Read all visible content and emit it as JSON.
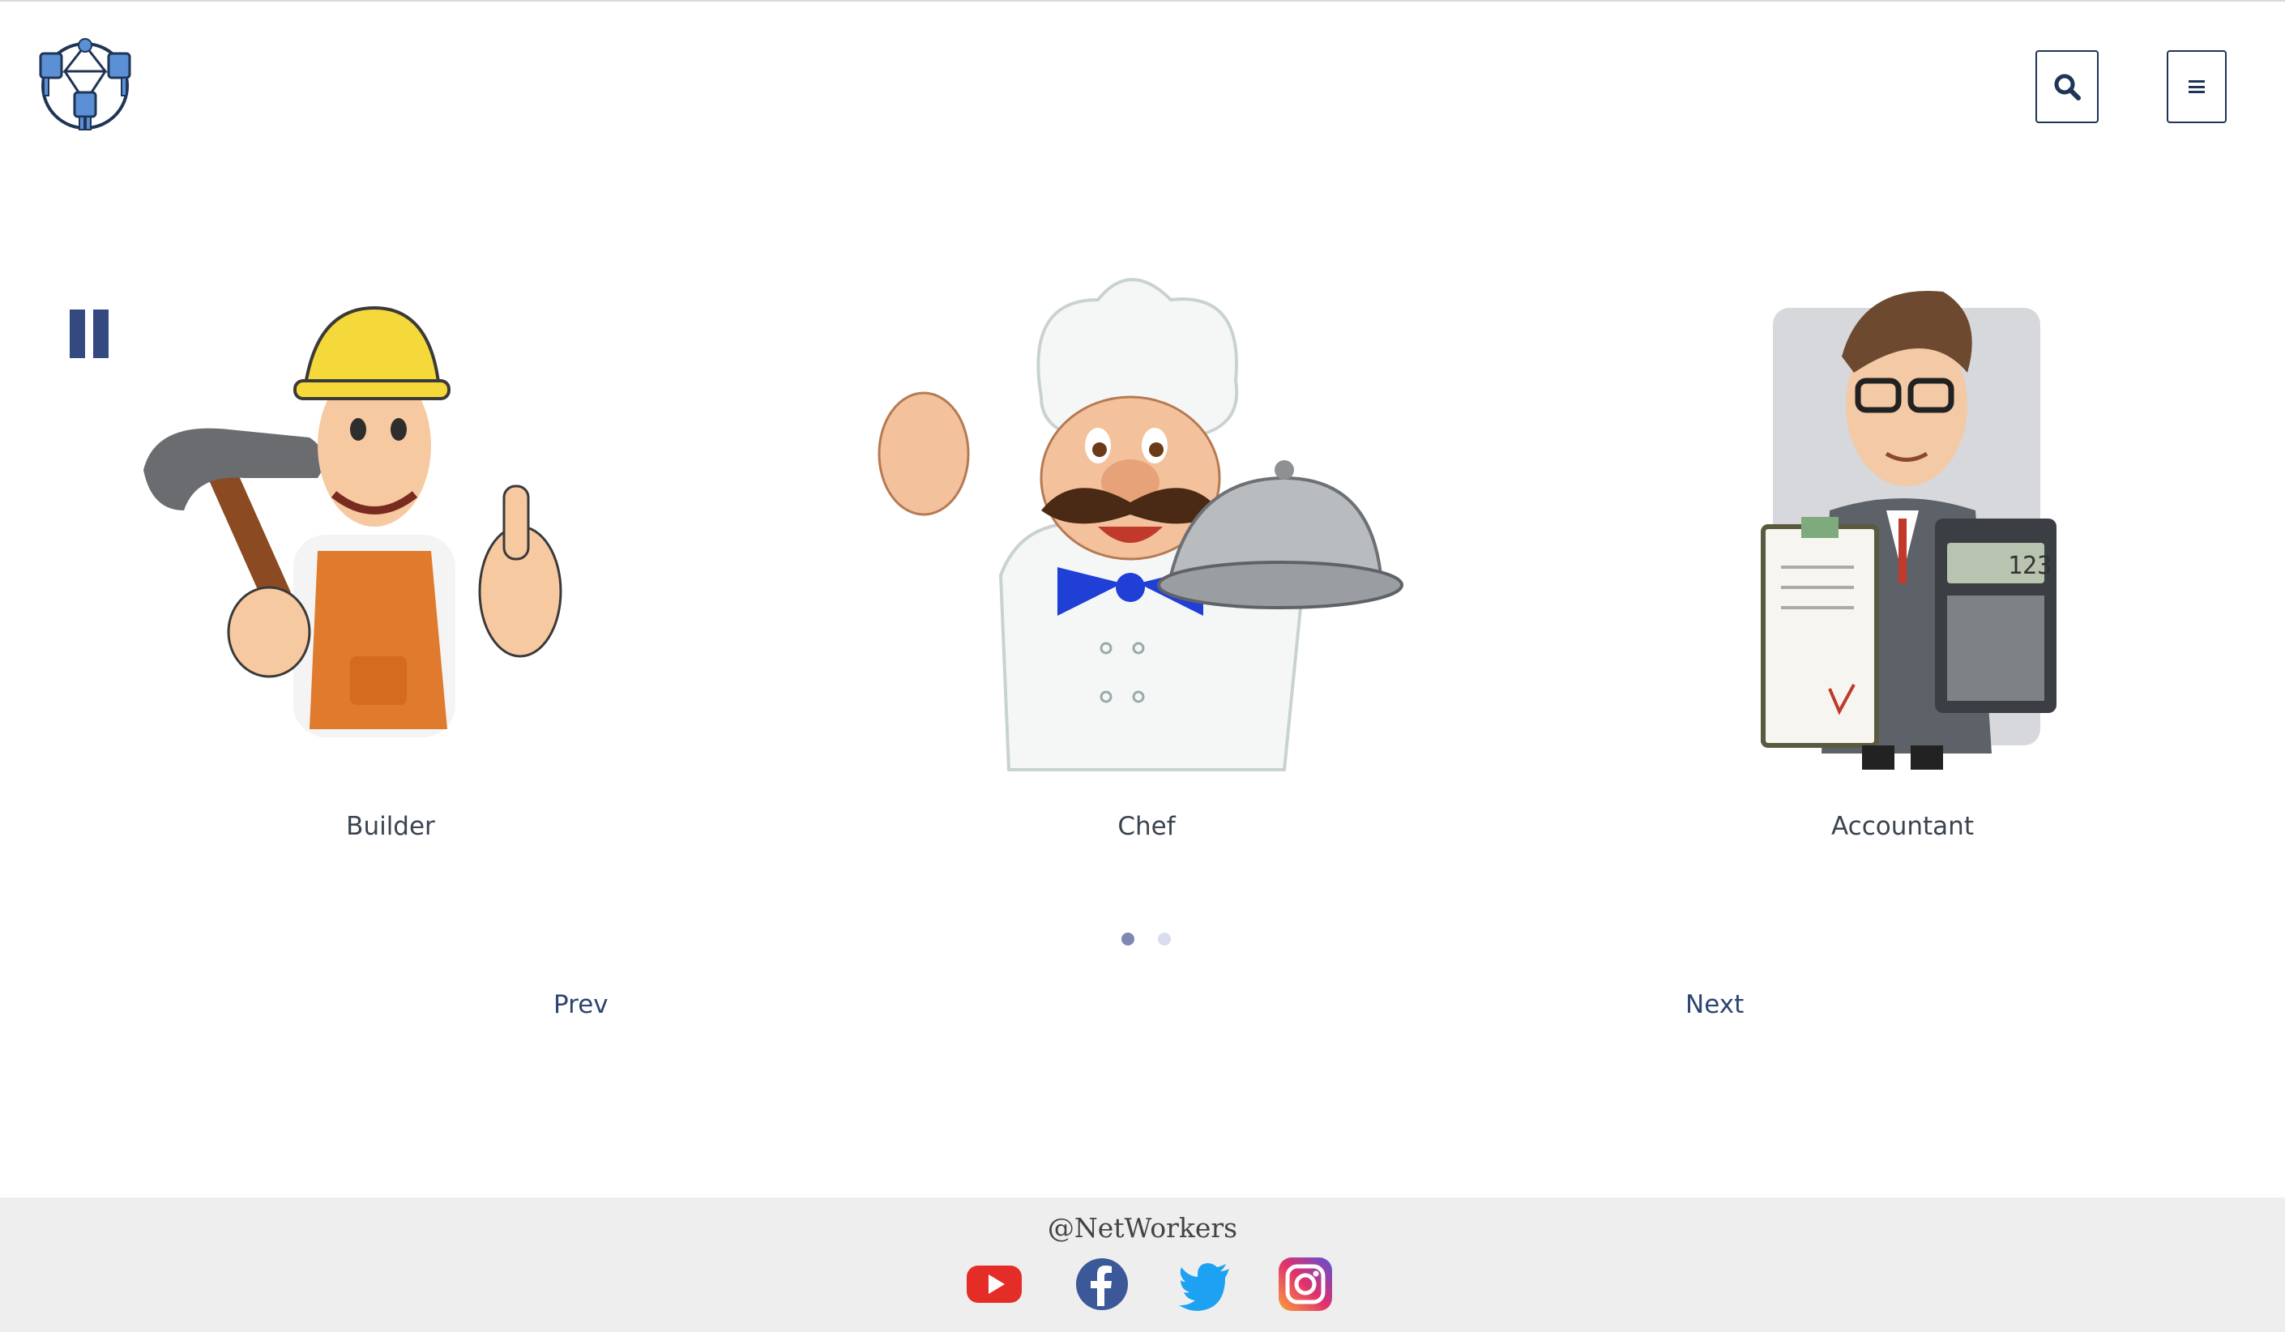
{
  "header": {
    "logo_icon": "network-people-logo",
    "search_icon": "search-icon",
    "menu_icon": "hamburger-menu-icon"
  },
  "carousel": {
    "pause_icon": "pause-icon",
    "slides": [
      {
        "label": "Builder",
        "image": "builder-illustration"
      },
      {
        "label": "Chef",
        "image": "chef-illustration"
      },
      {
        "label": "Accountant",
        "image": "accountant-illustration"
      }
    ],
    "pagination": {
      "count": 2,
      "active_index": 0
    },
    "prev_label": "Prev",
    "next_label": "Next"
  },
  "footer": {
    "handle": "@NetWorkers",
    "social": [
      {
        "name": "youtube-icon",
        "color": "#e52d27"
      },
      {
        "name": "facebook-icon",
        "color": "#3b5998"
      },
      {
        "name": "twitter-icon",
        "color": "#1da1f2"
      },
      {
        "name": "instagram-icon",
        "color": "#c13584"
      }
    ]
  },
  "colors": {
    "primary": "#1f3556",
    "pause": "#34497f",
    "dot_active": "#7d88b3",
    "dot_inactive": "#d9dcee",
    "footer_bg": "#eeeeee"
  }
}
